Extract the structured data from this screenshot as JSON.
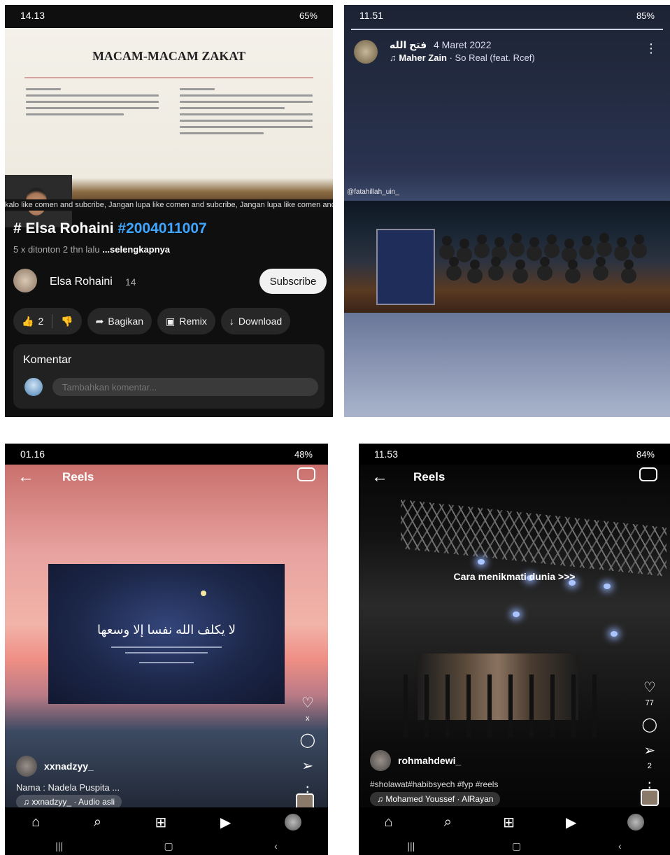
{
  "panel1": {
    "status": {
      "time": "14.13",
      "right": "65%"
    },
    "doc_title": "MACAM-MACAM ZAKAT",
    "ticker": "kalo like comen and subcribe, Jangan lupa like comen and subcribe, Jangan lupa like comen and subcribe, Jangan lu",
    "video_title_name": "# Elsa Rohaini ",
    "video_title_tag": "#2004011007",
    "meta": "5 x ditonton  2 thn lalu ",
    "meta_more": "...selengkapnya",
    "channel_name": "Elsa Rohaini",
    "channel_subs": "14",
    "subscribe_label": "Subscribe",
    "like_count": "2",
    "share_label": "Bagikan",
    "remix_label": "Remix",
    "download_label": "Download",
    "comments_title": "Komentar",
    "comment_placeholder": "Tambahkan komentar..."
  },
  "panel2": {
    "status": {
      "time": "11.51",
      "right": "85%"
    },
    "story_name": "فتح الله",
    "story_date": "4 Maret 2022",
    "music_artist": "Maher Zain",
    "music_song": " · So Real (feat. Rcef)",
    "photo_tag": "@fatahillah_uin_"
  },
  "panel3": {
    "status": {
      "time": "01.16",
      "right": "48%"
    },
    "header": "Reels",
    "arabic_text": "لا يكلف الله نفسا إلا وسعها",
    "username": "xxnadzyy_",
    "caption": "Nama : Nadela Puspita ...",
    "audio": "xxnadzyy_ · Audio asli",
    "like_count": "x",
    "icons": {
      "home": "home-icon",
      "search": "search-icon"
    }
  },
  "panel4": {
    "status": {
      "time": "11.53",
      "right": "84%"
    },
    "header": "Reels",
    "overlay_text": "Cara menikmati dunia >>>",
    "username": "rohmahdewi_",
    "hashtags": "#sholawat#habibsyech #fyp #reels",
    "audio": "Mohamed Youssef · AlRayan",
    "like_count": "77",
    "share_count": "2"
  }
}
